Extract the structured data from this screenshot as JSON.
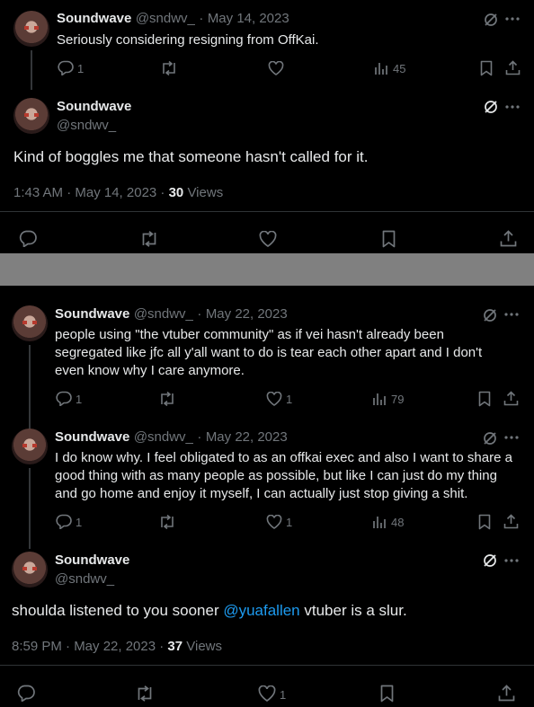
{
  "colors": {
    "background": "#000000",
    "text": "#e7e9ea",
    "muted": "#71767b",
    "link": "#1d9bf0",
    "band": "#808080"
  },
  "thread1": {
    "reply": {
      "name": "Soundwave",
      "handle": "@sndwv_",
      "date": "May 14, 2023",
      "text": "Seriously considering resigning from OffKai.",
      "replies": "1",
      "views": "45"
    },
    "main": {
      "name": "Soundwave",
      "handle": "@sndwv_",
      "text": "Kind of boggles me that someone hasn't called for it.",
      "timestamp": "1:43 AM · May 14, 2023 · ",
      "views_count": "30",
      "views_label": " Views"
    }
  },
  "thread2": {
    "tweet1": {
      "name": "Soundwave",
      "handle": "@sndwv_",
      "date": "May 22, 2023",
      "text": "people using \"the vtuber community\" as if vei hasn't already been segregated like jfc all y'all want to do is tear each other apart and I don't even know why I care anymore.",
      "replies": "1",
      "likes": "1",
      "views": "79"
    },
    "tweet2": {
      "name": "Soundwave",
      "handle": "@sndwv_",
      "date": "May 22, 2023",
      "text": "I do know why. I feel obligated to as an offkai exec and also I want to share a good thing with as many people as possible, but like I can just do my thing and go home and enjoy it myself, I can actually just stop giving a shit.",
      "replies": "1",
      "likes": "1",
      "views": "48"
    },
    "main": {
      "name": "Soundwave",
      "handle": "@sndwv_",
      "text_before": "shoulda listened to you sooner ",
      "mention": "@yuafallen",
      "text_after": " vtuber is a slur.",
      "timestamp": "8:59 PM · May 22, 2023 · ",
      "views_count": "37",
      "views_label": " Views",
      "likes": "1"
    }
  },
  "icons": [
    "grok-icon",
    "more-icon",
    "reply-icon",
    "retweet-icon",
    "like-icon",
    "views-icon",
    "bookmark-icon",
    "share-icon"
  ]
}
